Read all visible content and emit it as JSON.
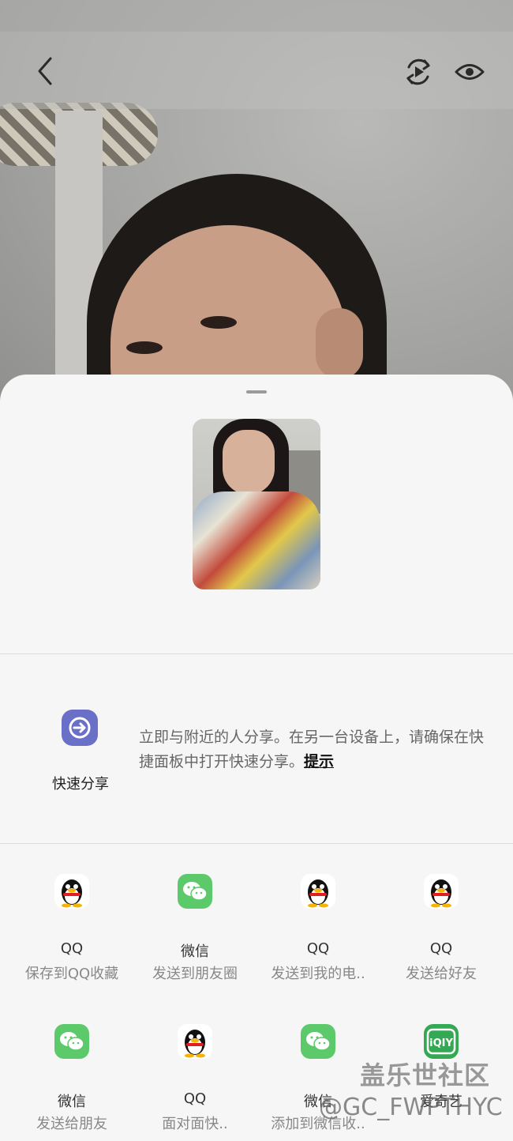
{
  "viewer": {
    "back_icon": "chevron-left-icon",
    "rotate_icon": "rotate-play-icon",
    "eye_icon": "eye-icon"
  },
  "share_sheet": {
    "quick_share": {
      "label": "快速分享",
      "description": "立即与附近的人分享。在另一台设备上，请确保在快捷面板中打开快速分享。",
      "hint_link": "提示",
      "icon": "quick-share-icon",
      "icon_color": "#6a6fc8"
    },
    "targets": [
      {
        "app": "QQ",
        "action": "保存到QQ收藏",
        "icon": "qq-icon"
      },
      {
        "app": "微信",
        "action": "发送到朋友圈",
        "icon": "wechat-icon"
      },
      {
        "app": "QQ",
        "action": "发送到我的电..",
        "icon": "qq-icon"
      },
      {
        "app": "QQ",
        "action": "发送给好友",
        "icon": "qq-icon"
      },
      {
        "app": "微信",
        "action": "发送给朋友",
        "icon": "wechat-icon"
      },
      {
        "app": "QQ",
        "action": "面对面快..",
        "icon": "qq-icon"
      },
      {
        "app": "微信",
        "action": "添加到微信收..",
        "icon": "wechat-icon"
      },
      {
        "app": "爱奇艺",
        "action": "",
        "icon": "iqiyi-icon"
      }
    ]
  },
  "watermark": {
    "line1": "盖乐世社区",
    "line2": "@GC_FWPTHYC"
  }
}
